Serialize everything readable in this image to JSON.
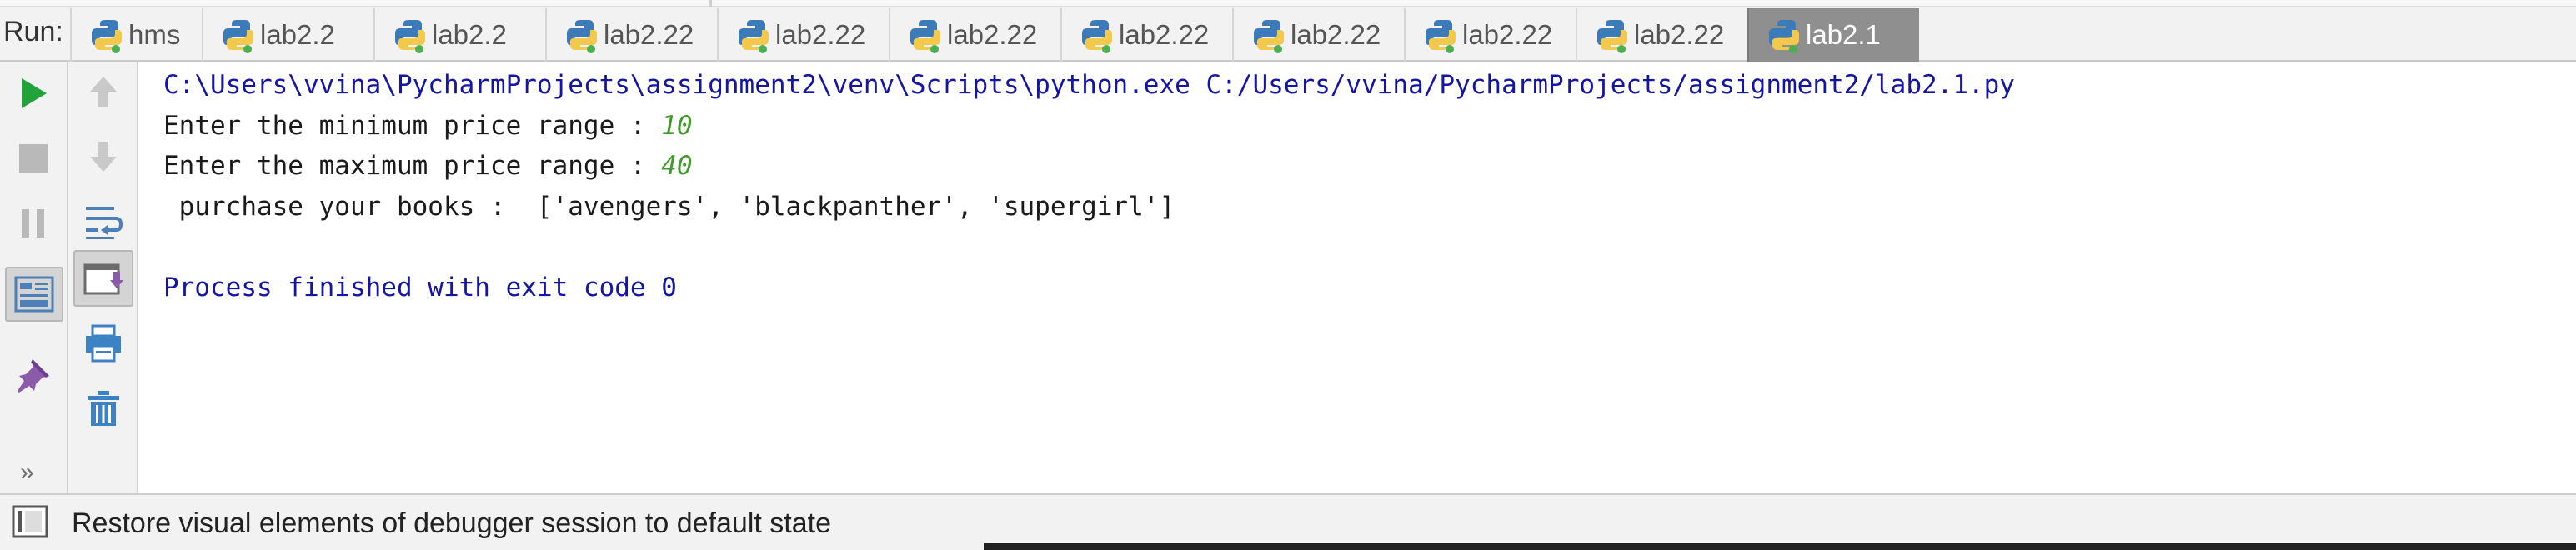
{
  "run_label": "Run:",
  "tabs": [
    {
      "label": "hms",
      "active": false
    },
    {
      "label": "lab2.2",
      "active": false
    },
    {
      "label": "lab2.2",
      "active": false
    },
    {
      "label": "lab2.22",
      "active": false
    },
    {
      "label": "lab2.22",
      "active": false
    },
    {
      "label": "lab2.22",
      "active": false
    },
    {
      "label": "lab2.22",
      "active": false
    },
    {
      "label": "lab2.22",
      "active": false
    },
    {
      "label": "lab2.22",
      "active": false
    },
    {
      "label": "lab2.22",
      "active": false
    },
    {
      "label": "lab2.1",
      "active": true
    }
  ],
  "left_toolbar": {
    "icons": [
      "run-icon",
      "stop-icon",
      "pause-icon",
      "restore-layout-icon",
      "pin-icon"
    ],
    "more": "»"
  },
  "second_toolbar": {
    "icons": [
      "up-arrow-icon",
      "down-arrow-icon",
      "soft-wrap-icon",
      "scroll-to-end-icon",
      "print-icon",
      "trash-icon"
    ]
  },
  "console": {
    "command": "C:\\Users\\vvina\\PycharmProjects\\assignment2\\venv\\Scripts\\python.exe C:/Users/vvina/PycharmProjects/assignment2/lab2.1.py",
    "prompt_min": "Enter the minimum price range : ",
    "input_min": "10",
    "prompt_max": "Enter the maximum price range : ",
    "input_max": "40",
    "result": " purchase your books :  ['avengers', 'blackpanther', 'supergirl']",
    "exit": "Process finished with exit code 0"
  },
  "status": {
    "text": "Restore visual elements of debugger session to default state"
  },
  "colors": {
    "accent_blue": "#1515a3",
    "input_green": "#3f9a2a",
    "run_green": "#21a33a",
    "icon_blue": "#3d82c4",
    "pin_purple": "#8b5aa8"
  }
}
